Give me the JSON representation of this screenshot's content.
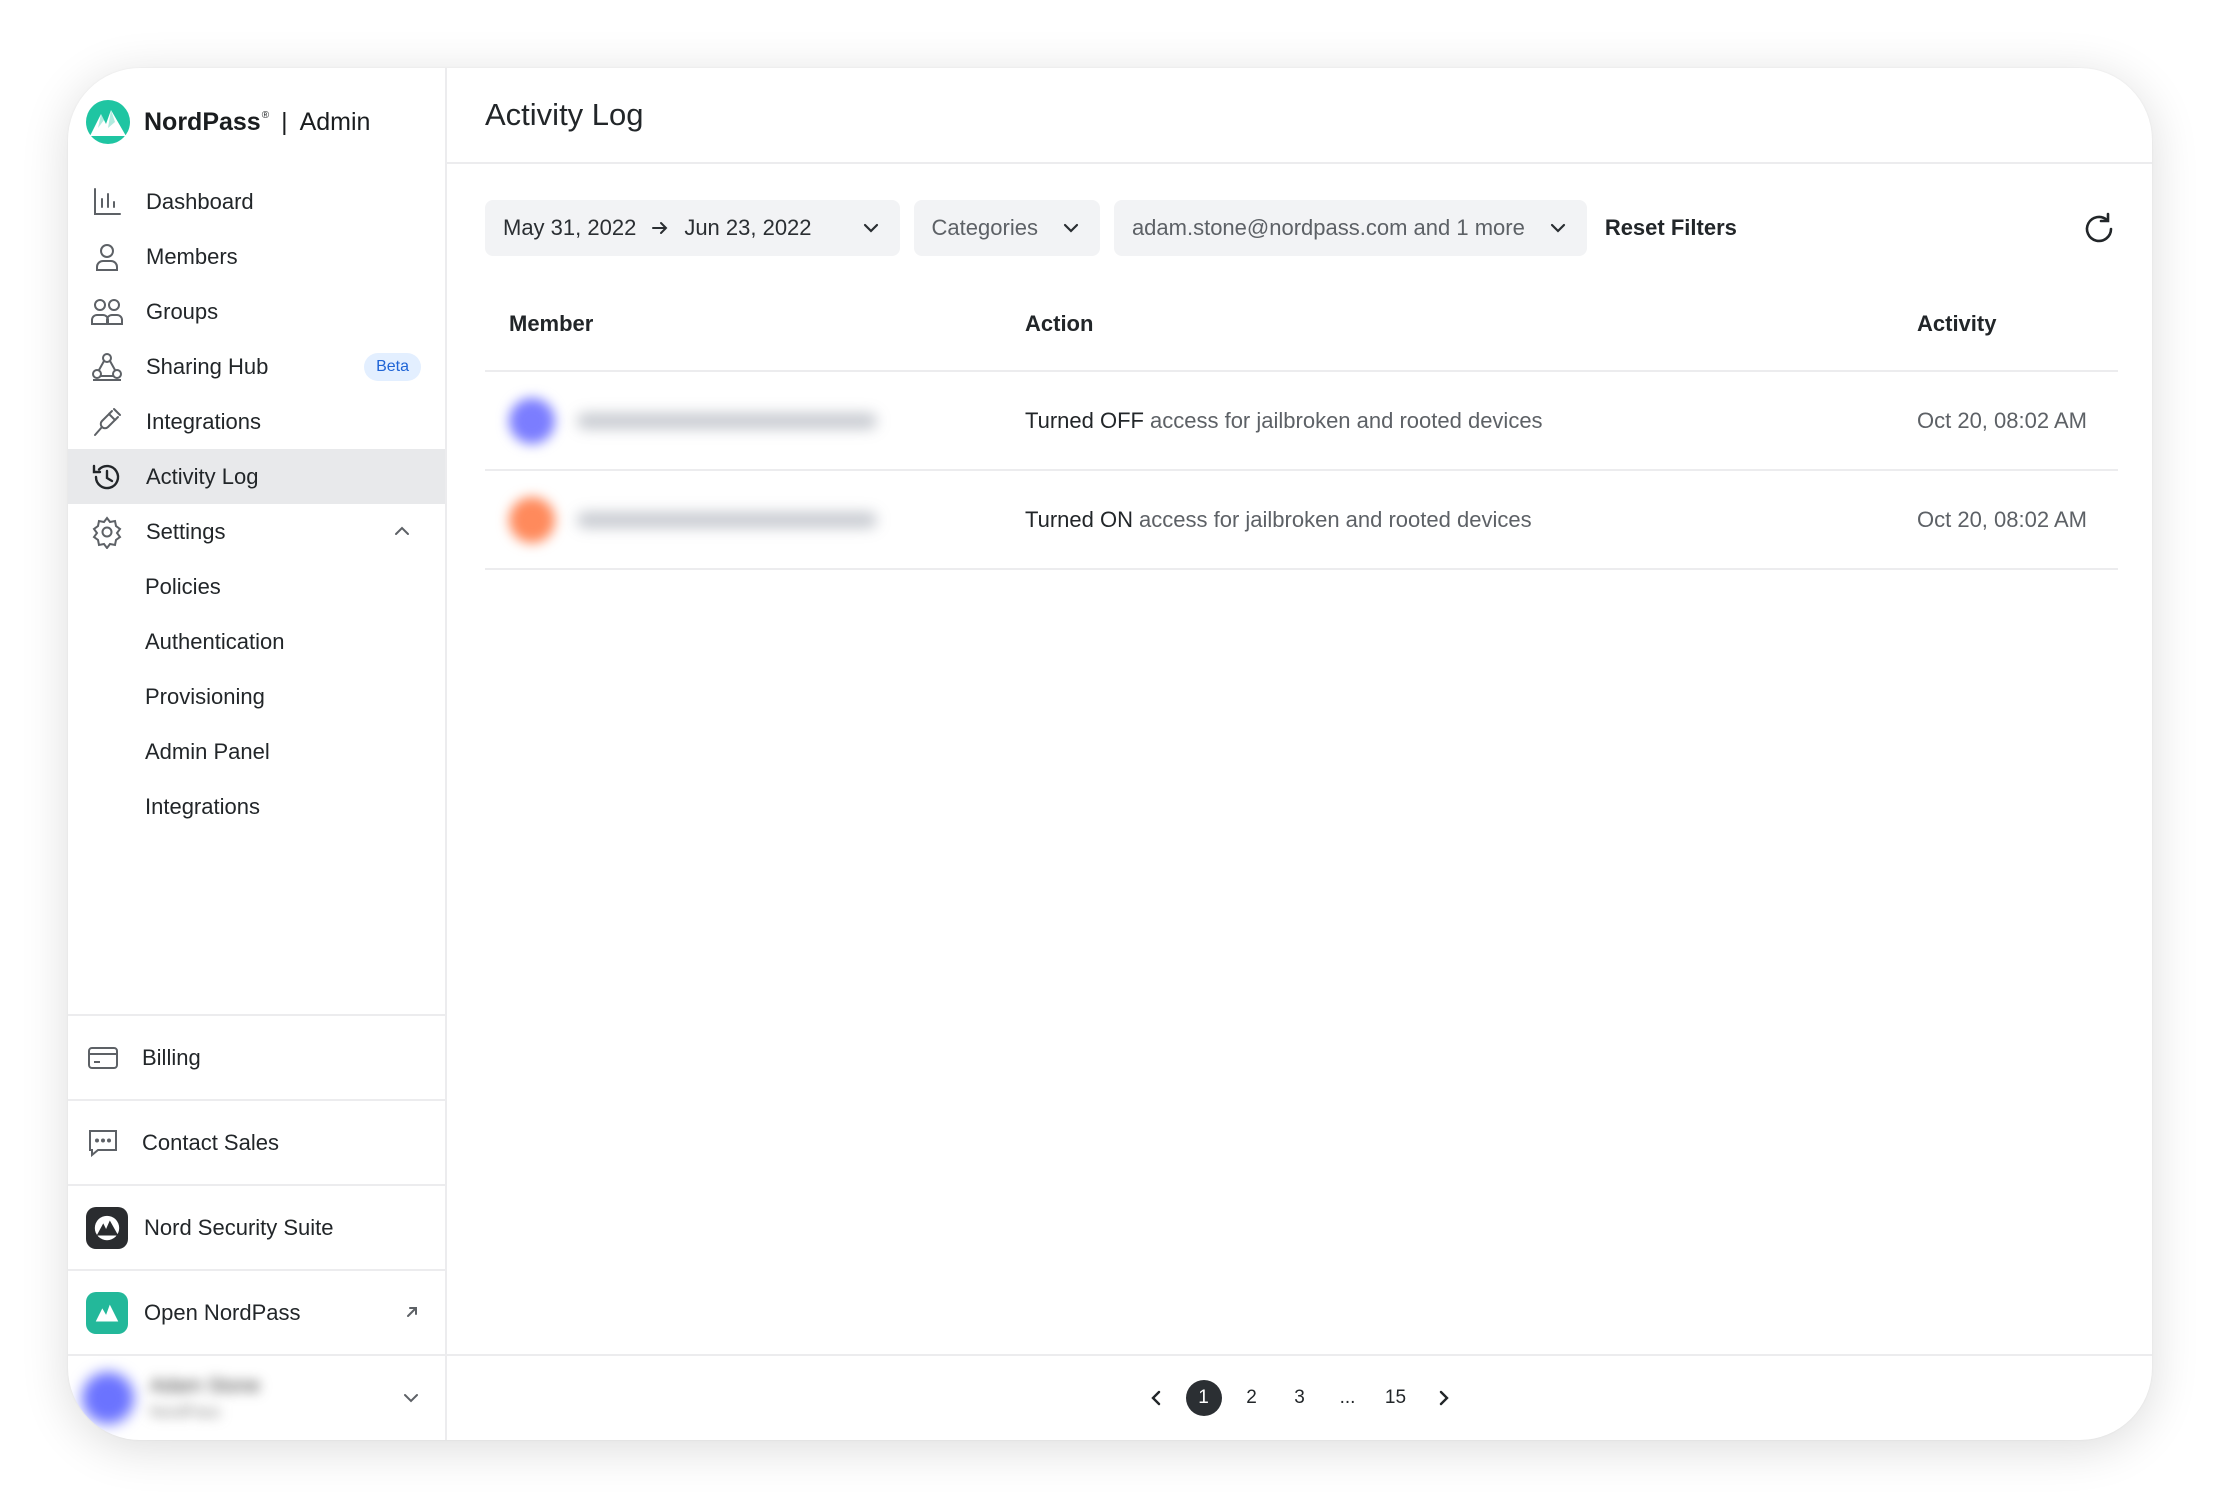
{
  "brand": {
    "name": "NordPass",
    "trademark": "®",
    "separator": "|",
    "product": "Admin"
  },
  "sidebar": {
    "items": [
      {
        "label": "Dashboard",
        "icon": "bar-chart-icon"
      },
      {
        "label": "Members",
        "icon": "person-icon"
      },
      {
        "label": "Groups",
        "icon": "people-icon"
      },
      {
        "label": "Sharing Hub",
        "icon": "sharing-hub-icon",
        "badge": "Beta"
      },
      {
        "label": "Integrations",
        "icon": "plug-icon"
      },
      {
        "label": "Activity Log",
        "icon": "history-icon",
        "active": true
      },
      {
        "label": "Settings",
        "icon": "gear-icon",
        "expanded": true
      }
    ],
    "settings_sub": [
      "Policies",
      "Authentication",
      "Provisioning",
      "Admin Panel",
      "Integrations"
    ],
    "bottom": {
      "billing": "Billing",
      "contact_sales": "Contact Sales",
      "suite": "Nord Security Suite",
      "open_app": "Open NordPass"
    },
    "user": {
      "name": "Adam Stone",
      "org": "NordPass"
    }
  },
  "main": {
    "title": "Activity Log",
    "filters": {
      "date_from": "May 31, 2022",
      "date_to": "Jun 23, 2022",
      "categories": "Categories",
      "members": "adam.stone@nordpass.com and 1 more",
      "reset": "Reset Filters"
    },
    "table": {
      "headers": {
        "member": "Member",
        "action": "Action",
        "activity": "Activity"
      },
      "rows": [
        {
          "avatar_color": "#7b7dff",
          "action_strong": "Turned OFF",
          "action_rest": "access for jailbroken and rooted devices",
          "time": "Oct 20, 08:02 AM"
        },
        {
          "avatar_color": "#ff8a5c",
          "action_strong": "Turned ON",
          "action_rest": "access for jailbroken and rooted devices",
          "time": "Oct 20, 08:02 AM"
        }
      ]
    },
    "pagination": {
      "pages": [
        "1",
        "2",
        "3",
        "...",
        "15"
      ],
      "current": "1"
    }
  },
  "colors": {
    "accent": "#1fc5a2",
    "active_bg": "#e8e9eb",
    "beta_bg": "#e3efff",
    "beta_text": "#1f64d6"
  }
}
